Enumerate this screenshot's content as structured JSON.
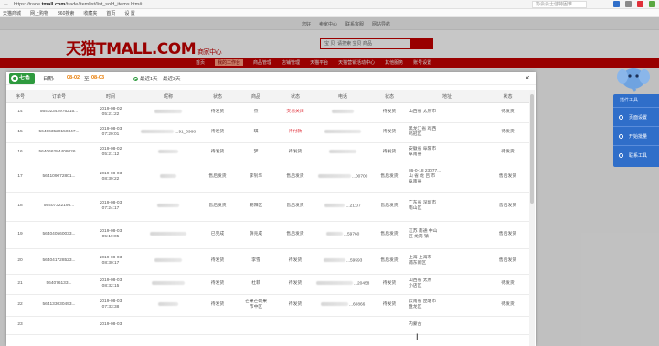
{
  "browser": {
    "url_prefix": "https://trade.",
    "url_domain": "tmall.com",
    "url_path": "/trade/itemlist/list_sold_items.htm#",
    "search_placeholder": "协会会士佳特困难",
    "bookmarks": [
      "天猫商城",
      "网上购物",
      "360搜索",
      "收藏夹",
      "首页",
      "设 置"
    ]
  },
  "tmall": {
    "top_links": [
      "您好",
      "卖家中心",
      "联系客服",
      "网站导航"
    ],
    "logo": "天猫TMALL.COM",
    "logo_sub": "商家中心",
    "search_scope": "宝 贝",
    "search_text": "请搜索 宝贝 商品",
    "nav_items": [
      "首页",
      "我的工作台",
      "商品管理",
      "店铺管理",
      "天猫平台",
      "天猫营销活动中心",
      "其他服务",
      "账号设置"
    ],
    "nav_active_index": 1
  },
  "side_panel": {
    "title": "插件工具",
    "items": [
      "页面设置",
      "开始批量",
      "联系工具"
    ]
  },
  "modal": {
    "brand": "七色查",
    "date_label": "日期:",
    "date_from": "08-02",
    "date_sep": "至",
    "date_to": "08-03",
    "radio_1": "最近1天",
    "radio_2": "最近3天",
    "close": "×",
    "columns": [
      "序号",
      "订单号",
      "时间",
      "昵称",
      "状态",
      "商品",
      "状态",
      "电话",
      "状态",
      "地址",
      "状态"
    ],
    "rows": [
      {
        "no": "14",
        "order": "56402342976215...",
        "time": "2019-08-02\n05:21:22",
        "nick": "",
        "s1": "待发货",
        "item": "杰",
        "s2": "交易关闭",
        "s2_red": true,
        "phone": "",
        "s3": "待发货",
        "addr": "山西省 太原市",
        "s4": "待发货"
      },
      {
        "no": "15",
        "order": "564063520150347...",
        "time": "2019-08-03\n07:20:01",
        "nick": "...91_0968",
        "s1": "待发货",
        "item": "琪",
        "s2": "待付款",
        "s2_red": true,
        "phone": "",
        "s3": "待发货",
        "addr": "黑龙江省 鸡西\n鸡冠区",
        "s4": "待发货"
      },
      {
        "no": "16",
        "order": "564066284408026...",
        "time": "2019-08-02\n05:21:12",
        "nick": "",
        "s1": "待发货",
        "item": "梦",
        "s2": "待发货",
        "s2_red": false,
        "phone": "",
        "s3": "待发货",
        "addr": "安徽省 阜阳市\n阜南县",
        "s4": "待发货"
      },
      {
        "no": "17",
        "order": "564109072801...",
        "time": "2019-08-03\n08:39:22",
        "nick": "",
        "s1": "售后发货",
        "item": "李钊华",
        "s2": "售后发货",
        "s2_red": false,
        "phone": "...00700",
        "s3": "售后发货",
        "addr": "86-0-18 23077...\n山 省 龙 吕 市\n阜南县",
        "s4": "售后发货"
      },
      {
        "no": "18",
        "order": "56407322195...",
        "time": "2019-08-03\n07:24:17",
        "nick": "",
        "s1": "售后发货",
        "item": "朝阳区",
        "s2": "售后发货",
        "s2_red": false,
        "phone": "...21:07",
        "s3": "售后发货",
        "addr": "广东省 深圳市\n南山区",
        "s4": "售后发货"
      },
      {
        "no": "19",
        "order": "564040560033...",
        "time": "2019-08-03\n05:19:05",
        "nick": "",
        "s1": "已完成",
        "item": "薛兆成",
        "s2": "售后发货",
        "s2_red": false,
        "phone": "...59760",
        "s3": "售后发货",
        "addr": "江苏 南通 中山\n区 龙岗 镇",
        "s4": "售后发货"
      },
      {
        "no": "20",
        "order": "564041728523...",
        "time": "2019-08-03\n08:30:17",
        "nick": "",
        "s1": "待发货",
        "item": "李雪",
        "s2": "待发货",
        "s2_red": false,
        "phone": "...59593",
        "s3": "售后发货",
        "addr": "上海 上海市\n浦东新区",
        "s4": "售后发货"
      },
      {
        "no": "21",
        "order": "564076133...",
        "time": "2019-08-03\n08:32:15",
        "nick": "",
        "s1": "待发货",
        "item": "杜菲",
        "s2": "待发货",
        "s2_red": false,
        "phone": "...20458",
        "s3": "待发货",
        "addr": "山西省 太原\n小店区",
        "s4": "待发货"
      },
      {
        "no": "22",
        "order": "564133030493...",
        "time": "2019-08-03\n07:33:38",
        "nick": "",
        "s1": "待发货",
        "item": "芒果芒硕果\n市中区",
        "s2": "待发货",
        "s2_red": false,
        "phone": "...60866",
        "s3": "待发货",
        "addr": "云南省 昆明市\n盘龙区",
        "s4": "待发货"
      },
      {
        "no": "23",
        "order": "",
        "time": "2019-08-03",
        "nick": "",
        "s1": "",
        "item": "",
        "s2": "",
        "s2_red": false,
        "phone": "",
        "s3": "",
        "addr": "内蒙古",
        "s4": ""
      }
    ]
  }
}
